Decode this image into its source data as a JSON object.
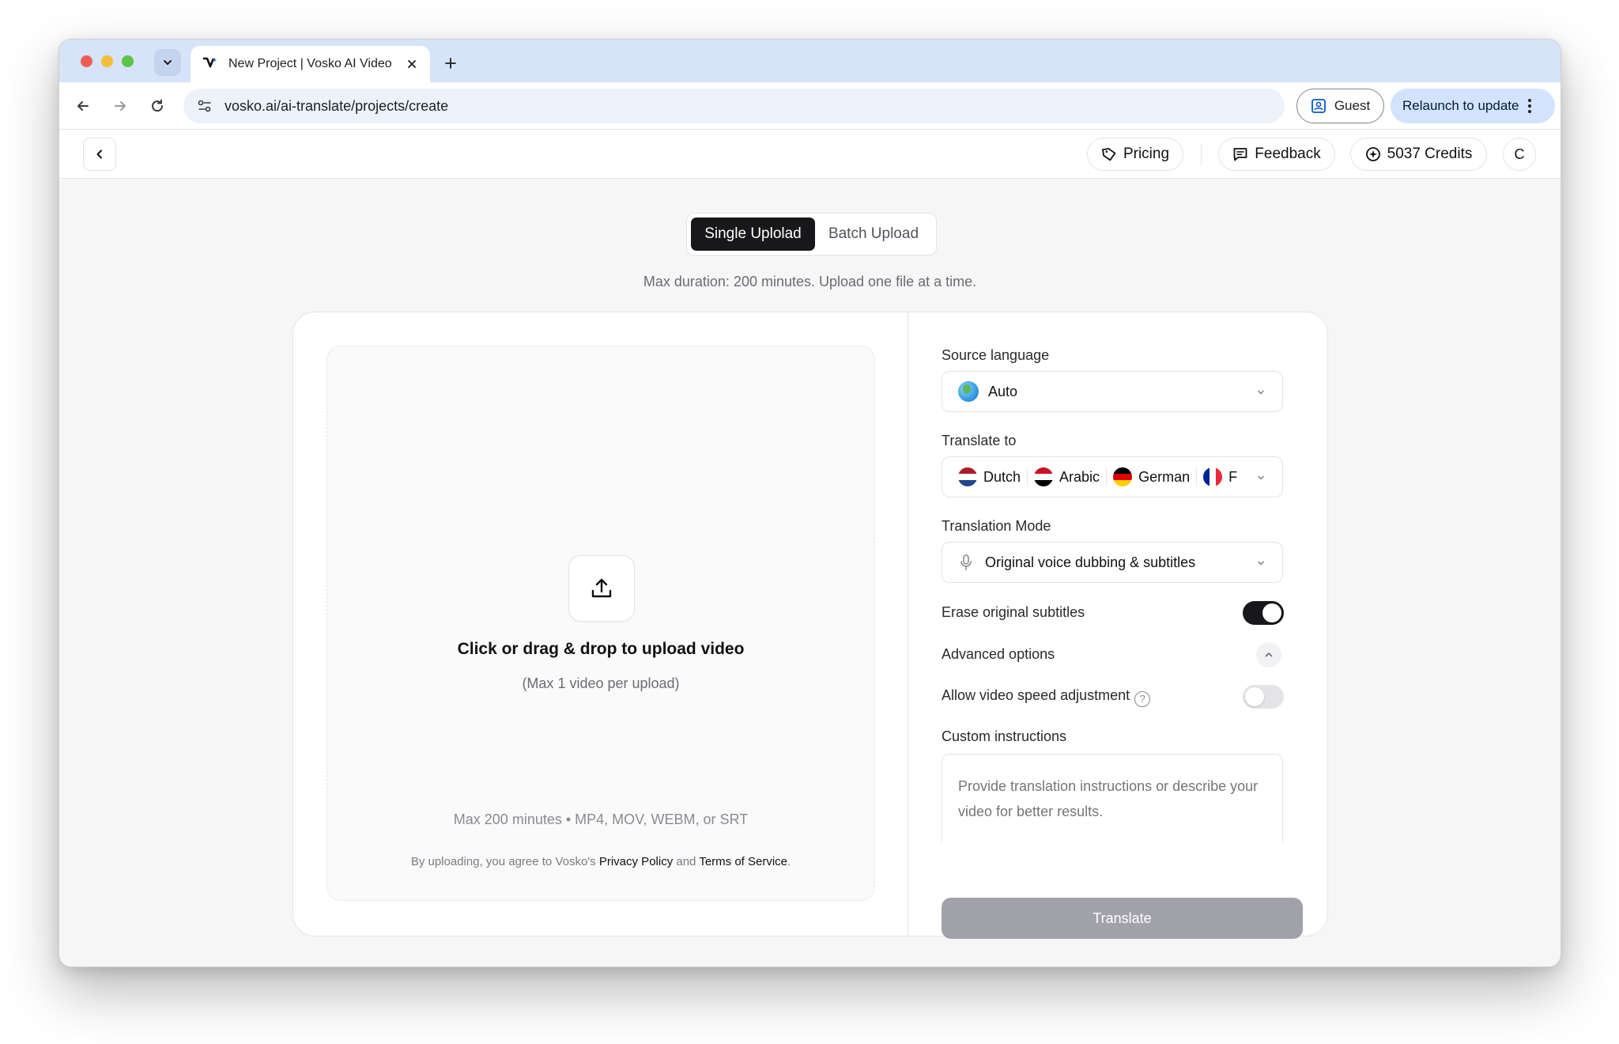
{
  "browser": {
    "tab_title": "New Project | Vosko AI Video",
    "url": "vosko.ai/ai-translate/projects/create",
    "guest_label": "Guest",
    "relaunch_label": "Relaunch to update"
  },
  "header": {
    "pricing_label": "Pricing",
    "feedback_label": "Feedback",
    "credits_label": "5037 Credits",
    "avatar_initial": "C"
  },
  "upload_mode": {
    "single_label": "Single Uplolad",
    "batch_label": "Batch Upload",
    "selected": "single",
    "note": "Max duration: 200 minutes. Upload one file at a time."
  },
  "dropzone": {
    "title": "Click or drag & drop to upload video",
    "subtitle": "(Max 1 video per upload)",
    "formats": "Max 200 minutes • MP4, MOV, WEBM, or SRT",
    "legal_prefix": "By uploading, you agree to Vosko's",
    "privacy_link": "Privacy Policy",
    "legal_and": "and",
    "terms_link": "Terms of Service",
    "legal_suffix": "."
  },
  "settings": {
    "source_language_label": "Source language",
    "source_language_value": "Auto",
    "translate_to_label": "Translate to",
    "translate_to": [
      {
        "name": "Dutch",
        "flag": "nl"
      },
      {
        "name": "Arabic",
        "flag": "eg"
      },
      {
        "name": "German",
        "flag": "de"
      },
      {
        "name": "F",
        "flag": "fr"
      }
    ],
    "translation_mode_label": "Translation Mode",
    "translation_mode_value": "Original voice dubbing & subtitles",
    "erase_subtitles_label": "Erase original subtitles",
    "erase_subtitles_on": true,
    "advanced_options_label": "Advanced options",
    "advanced_options_expanded": true,
    "speed_adjust_label": "Allow video speed adjustment",
    "speed_adjust_on": false,
    "custom_instructions_label": "Custom instructions",
    "custom_instructions_placeholder": "Provide translation instructions or describe your video for better results.",
    "translate_button": "Translate"
  },
  "colors": {
    "tabstrip": "#d6e3f8",
    "primary_dark": "#18181b",
    "disabled_button": "#a1a1aa",
    "relaunch_bg": "#d3e3fd"
  }
}
